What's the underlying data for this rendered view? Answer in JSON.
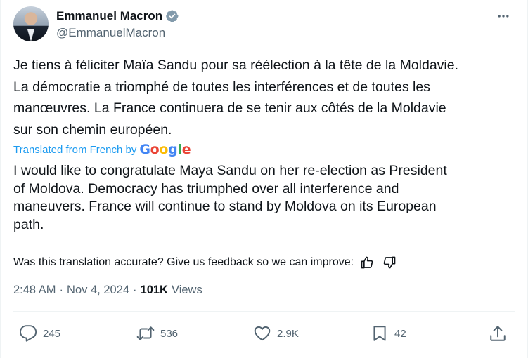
{
  "author": {
    "display_name": "Emmanuel Macron",
    "handle": "@EmmanuelMacron"
  },
  "tweet": {
    "original_text": "Je tiens à féliciter Maïa Sandu pour sa réélection à la tête de la Moldavie.\nLa démocratie a triomphé de toutes les interférences et de toutes les\nmanœuvres. La France continuera de se tenir aux côtés de la Moldavie\nsur son chemin européen.",
    "translated_label": "Translated from French by",
    "translator_logo": "Google",
    "translated_text": "I would like to congratulate Maya Sandu on her re-election as President\nof Moldova. Democracy has triumphed over all interference and\nmaneuvers. France will continue to stand by Moldova on its European\npath.",
    "feedback_prompt": "Was this translation accurate? Give us feedback so we can improve:",
    "time": "2:48 AM",
    "date": "Nov 4, 2024",
    "views_count": "101K",
    "views_label": "Views",
    "separator": "·"
  },
  "actions": {
    "replies": "245",
    "reposts": "536",
    "likes": "2.9K",
    "bookmarks": "42"
  },
  "icons": {
    "verified": "verified-badge-icon",
    "more": "more-dots-icon",
    "reply": "reply-bubble-icon",
    "repost": "repost-arrows-icon",
    "like": "heart-icon",
    "bookmark": "bookmark-icon",
    "share": "share-upload-icon",
    "thumbs_up": "thumbs-up-icon",
    "thumbs_down": "thumbs-down-icon"
  },
  "colors": {
    "link_blue": "#1d9bf0",
    "secondary_text": "#536471",
    "primary_text": "#0f1419",
    "divider": "#eff3f4"
  }
}
